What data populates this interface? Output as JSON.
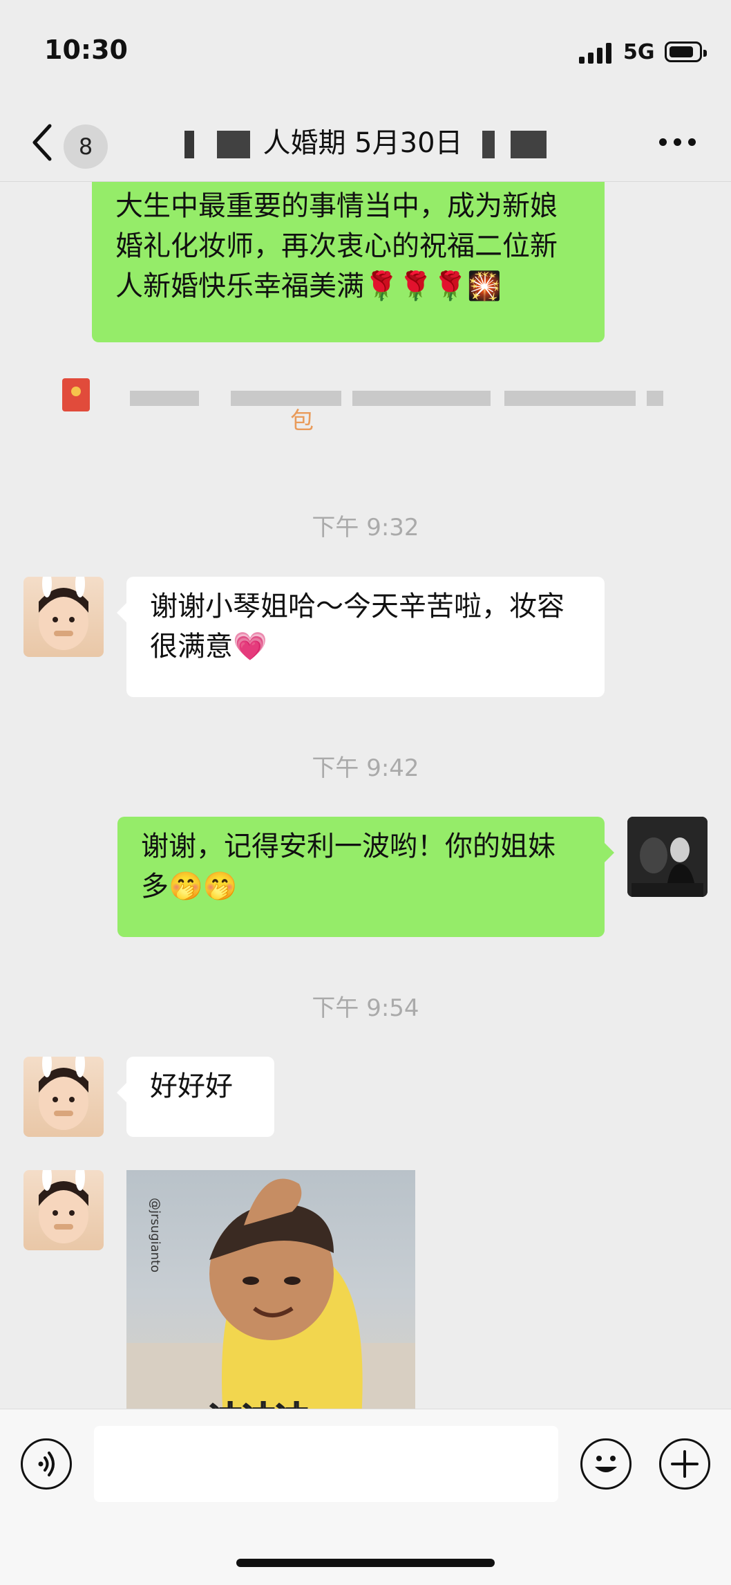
{
  "status_bar": {
    "time": "10:30",
    "network": "5G"
  },
  "header": {
    "unread_count": "8",
    "title_visible": "人婚期 5月30日"
  },
  "messages": {
    "m1_text": "大生中最重要的事情当中，成为新娘婚礼化妆师，再次衷心的祝福二位新人新婚快乐幸福美满🌹🌹🌹🎇",
    "redpacket_suffix": "包",
    "time1": "下午 9:32",
    "m2_text": "谢谢小琴姐哈～今天辛苦啦，妆容很满意💗",
    "time2": "下午 9:42",
    "m3_text": "谢谢，记得安利一波哟！你的姐妹多🤭🤭",
    "time3": "下午 9:54",
    "m4_text": "好好好",
    "sticker_watermark": "@jrsugianto",
    "sticker_caption": "冲冲冲"
  },
  "input": {
    "placeholder": ""
  },
  "icons": {
    "back": "chevron-left-icon",
    "more": "more-dots-icon",
    "voice": "voice-icon",
    "emoji": "emoji-icon",
    "plus": "plus-icon"
  },
  "colors": {
    "sent_bubble": "#95ec69",
    "received_bubble": "#ffffff",
    "background": "#ededed",
    "red_packet": "#e14b3b"
  }
}
